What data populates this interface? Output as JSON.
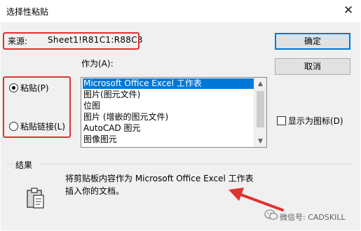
{
  "window": {
    "title": "选择性粘贴",
    "close_glyph": "✕"
  },
  "source": {
    "label": "来源:",
    "value": "Sheet1!R81C1:R88C3"
  },
  "buttons": {
    "ok": "确定",
    "cancel": "取消"
  },
  "paste_as": {
    "label": "作为(A):",
    "items": [
      "Microsoft Office Excel 工作表",
      "图片(图元文件)",
      "位图",
      "图片 (增嵌的图元文件)",
      "AutoCAD 图元",
      "图像图元"
    ],
    "selected_index": 0
  },
  "radios": {
    "paste": "粘贴(P)",
    "paste_link": "粘贴链接(L)",
    "selected": "paste"
  },
  "display_as_icon": {
    "label": "显示为图标(D)",
    "checked": false
  },
  "result": {
    "group_label": "结果",
    "line1": "将剪贴板内容作为 Microsoft Office Excel 工作表",
    "line2": "插入你的文档。"
  },
  "watermark": {
    "text": "微信号: CADSKILL"
  },
  "colors": {
    "highlight": "#e0322f",
    "selection": "#0078d7",
    "dialog_bg": "#f0f0f0"
  }
}
